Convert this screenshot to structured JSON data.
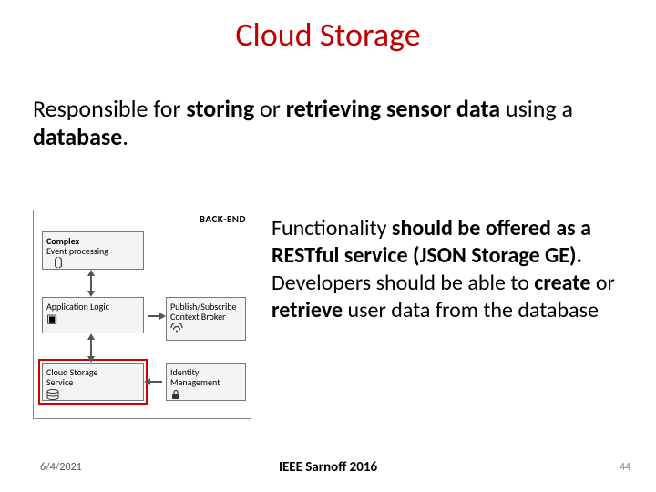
{
  "title": "Cloud Storage",
  "subtitle": {
    "pre": "Responsible for ",
    "b1": "storing",
    "mid1": " or ",
    "b2": "retrieving",
    "mid2": " ",
    "b3": "sensor data",
    "mid3": " using a ",
    "b4": "database",
    "post": "."
  },
  "diagram": {
    "backend": "BACK-END",
    "complex": {
      "l1": "Complex",
      "l2": "Event processing"
    },
    "applogic": {
      "l1": "Application Logic"
    },
    "pubsub": {
      "l1": "Publish/Subscribe",
      "l2": "Context Broker"
    },
    "cloud": {
      "l1": "Cloud Storage",
      "l2": "Service"
    },
    "identity": {
      "l1": "Identity",
      "l2": "Management"
    }
  },
  "body": {
    "p1a": "Functionality ",
    "p1b": "should be offered as a RESTful service (JSON Storage GE).",
    "p2a": "Developers should be able to ",
    "p2b": "create",
    "p2c": " or ",
    "p2d": "retrieve",
    "p2e": " user data from the database"
  },
  "footer": {
    "date": "6/4/2021",
    "center": "IEEE Sarnoff 2016",
    "page": "44"
  }
}
